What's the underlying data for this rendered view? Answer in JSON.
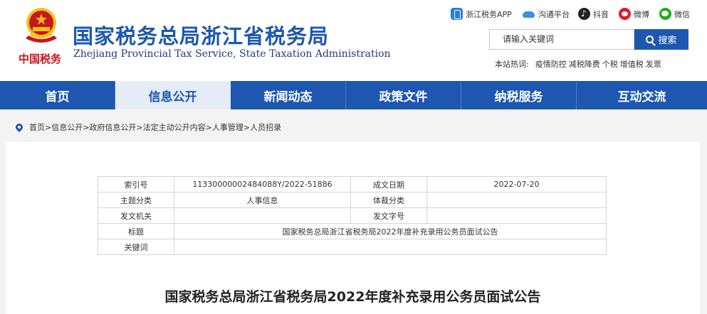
{
  "header": {
    "brand_sign": "中国税务",
    "title": "国家税务总局浙江省税务局",
    "subtitle": "Zhejiang Provincial Tax Service, State Taxation Administration",
    "social": [
      {
        "label": "浙江税务APP",
        "icon": "mobile-app-icon"
      },
      {
        "label": "沟通平台",
        "icon": "cloud-icon"
      },
      {
        "label": "抖音",
        "icon": "douyin-icon"
      },
      {
        "label": "微博",
        "icon": "weibo-icon"
      },
      {
        "label": "微信",
        "icon": "wechat-icon"
      }
    ],
    "search": {
      "placeholder": "请输入关键词",
      "button_label": "搜索"
    },
    "hotwords_label": "本站热词:",
    "hotwords": [
      "疫情防控",
      "减税降费",
      "个税",
      "增值税",
      "发票"
    ]
  },
  "nav": {
    "items": [
      "首页",
      "信息公开",
      "新闻动态",
      "政策文件",
      "纳税服务",
      "互动交流"
    ],
    "active_index": 1
  },
  "breadcrumb": "首页>信息公开>政府信息公开>法定主动公开内容>人事管理>人员招录",
  "meta": {
    "index_no_label": "索引号",
    "index_no": "11330000002484088Y/2022-51886",
    "date_label": "成文日期",
    "date": "2022-07-20",
    "topic_label": "主题分类",
    "topic": "人事信息",
    "genre_label": "体裁分类",
    "genre": "",
    "issuer_label": "发文机关",
    "issuer": "",
    "doc_no_label": "发文字号",
    "doc_no": "",
    "title_label": "标题",
    "title": "国家税务总局浙江省税务局2022年度补充录用公务员面试公告",
    "keywords_label": "关键词",
    "keywords": ""
  },
  "article": {
    "title": "国家税务总局浙江省税务局2022年度补充录用公务员面试公告"
  },
  "colors": {
    "brand_blue": "#1d57b0",
    "emblem_red": "#c8161d",
    "emblem_gold": "#f0c419"
  }
}
